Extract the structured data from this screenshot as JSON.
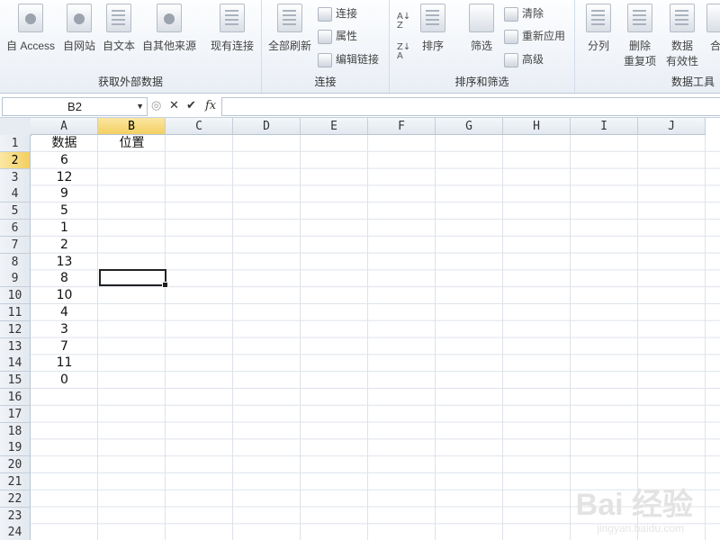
{
  "ribbon": {
    "groups": [
      {
        "label": "获取外部数据"
      },
      {
        "label": "连接"
      },
      {
        "label": "排序和筛选"
      },
      {
        "label": "数据工具"
      }
    ],
    "buttons": {
      "access": "自 Access",
      "web": "自网站",
      "text": "自文本",
      "other": "自其他来源",
      "existing": "现有连接",
      "refresh": "全部刷新",
      "connections": "连接",
      "properties": "属性",
      "edit_links": "编辑链接",
      "sort": "排序",
      "filter": "筛选",
      "clear": "清除",
      "reapply": "重新应用",
      "advanced": "高级",
      "split": "分列",
      "remove_dup_1": "删除",
      "remove_dup_2": "重复项",
      "validation_1": "数据",
      "validation_2": "有效性",
      "consolidate": "合"
    }
  },
  "formula_bar": {
    "name_box": "B2",
    "fx": "fx",
    "value": ""
  },
  "sheet": {
    "columns": [
      "A",
      "B",
      "C",
      "D",
      "E",
      "F",
      "G",
      "H",
      "I",
      "J"
    ],
    "active_column": "B",
    "active_row": 2,
    "rows": [
      "1",
      "2",
      "3",
      "4",
      "5",
      "6",
      "7",
      "8",
      "9",
      "10",
      "11",
      "12",
      "13",
      "14",
      "15",
      "16",
      "17",
      "18",
      "19",
      "20",
      "21",
      "22",
      "23",
      "24"
    ],
    "cells": {
      "A1": "数据",
      "B1": "位置",
      "A2": "6",
      "A3": "12",
      "A4": "9",
      "A5": "5",
      "A6": "1",
      "A7": "2",
      "A8": "13",
      "A9": "8",
      "A10": "10",
      "A11": "4",
      "A12": "3",
      "A13": "7",
      "A14": "11",
      "A15": "0"
    }
  },
  "watermark": {
    "main": "Bai 经验",
    "sub": "jingyan.baidu.com"
  }
}
